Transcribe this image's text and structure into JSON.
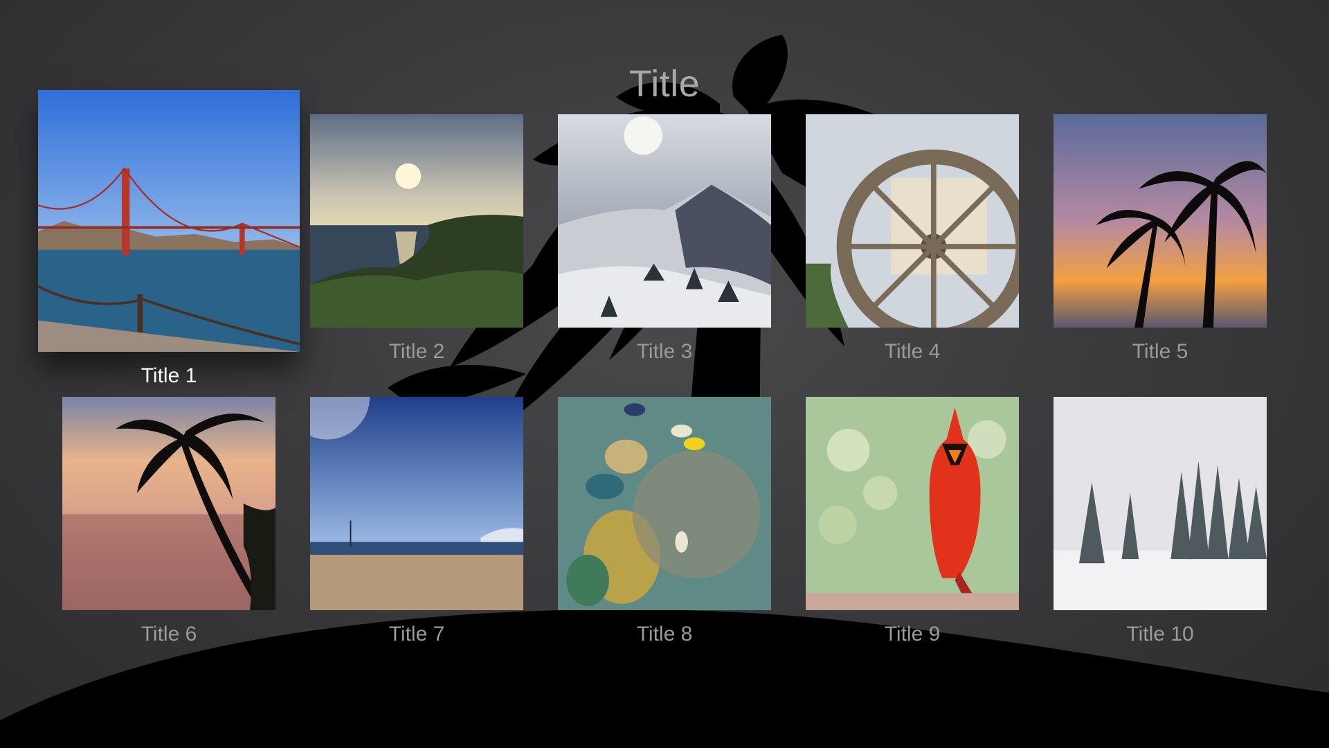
{
  "screen": {
    "title": "Title"
  },
  "grid": {
    "items": [
      {
        "label": "Title 1",
        "focused": true,
        "photo": "golden-gate-bridge"
      },
      {
        "label": "Title 2",
        "focused": false,
        "photo": "sunset-over-ocean-cliffs"
      },
      {
        "label": "Title 3",
        "focused": false,
        "photo": "snowy-mountain"
      },
      {
        "label": "Title 4",
        "focused": false,
        "photo": "water-wheel"
      },
      {
        "label": "Title 5",
        "focused": false,
        "photo": "palm-trees-sunset"
      },
      {
        "label": "Title 6",
        "focused": false,
        "photo": "palm-tree-beach-sunset"
      },
      {
        "label": "Title 7",
        "focused": false,
        "photo": "beach-sailboat"
      },
      {
        "label": "Title 8",
        "focused": false,
        "photo": "coral-reef-fish"
      },
      {
        "label": "Title 9",
        "focused": false,
        "photo": "red-cardinal"
      },
      {
        "label": "Title 10",
        "focused": false,
        "photo": "snowy-forest"
      }
    ]
  },
  "background": {
    "image": "palm-tree-silhouette",
    "colors": {
      "top": "#4a4a4c",
      "ground": "#000000"
    }
  }
}
